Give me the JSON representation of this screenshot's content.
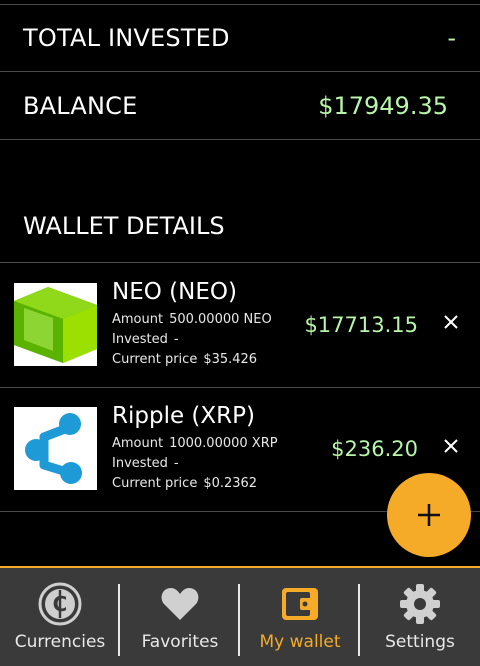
{
  "summary": {
    "total_invested_label": "TOTAL INVESTED",
    "total_invested_value": "-",
    "balance_label": "BALANCE",
    "balance_value": "$17949.35"
  },
  "wallet": {
    "title": "WALLET DETAILS",
    "coins": [
      {
        "name": "NEO (NEO)",
        "amount_label": "Amount",
        "amount": "500.00000 NEO",
        "invested_label": "Invested",
        "invested": "-",
        "price_label": "Current price",
        "price": "$35.426",
        "value": "$17713.15",
        "icon": "neo-logo-icon"
      },
      {
        "name": "Ripple (XRP)",
        "amount_label": "Amount",
        "amount": "1000.00000 XRP",
        "invested_label": "Invested",
        "invested": "-",
        "price_label": "Current price",
        "price": "$0.2362",
        "value": "$236.20",
        "icon": "ripple-logo-icon"
      }
    ]
  },
  "nav": {
    "items": [
      {
        "label": "Currencies",
        "icon": "currency-icon"
      },
      {
        "label": "Favorites",
        "icon": "heart-icon"
      },
      {
        "label": "My wallet",
        "icon": "wallet-icon"
      },
      {
        "label": "Settings",
        "icon": "gear-icon"
      }
    ]
  },
  "colors": {
    "accent": "#f5ab27",
    "positive": "#b8f5a8",
    "nav_bg": "#3a3a3a"
  }
}
